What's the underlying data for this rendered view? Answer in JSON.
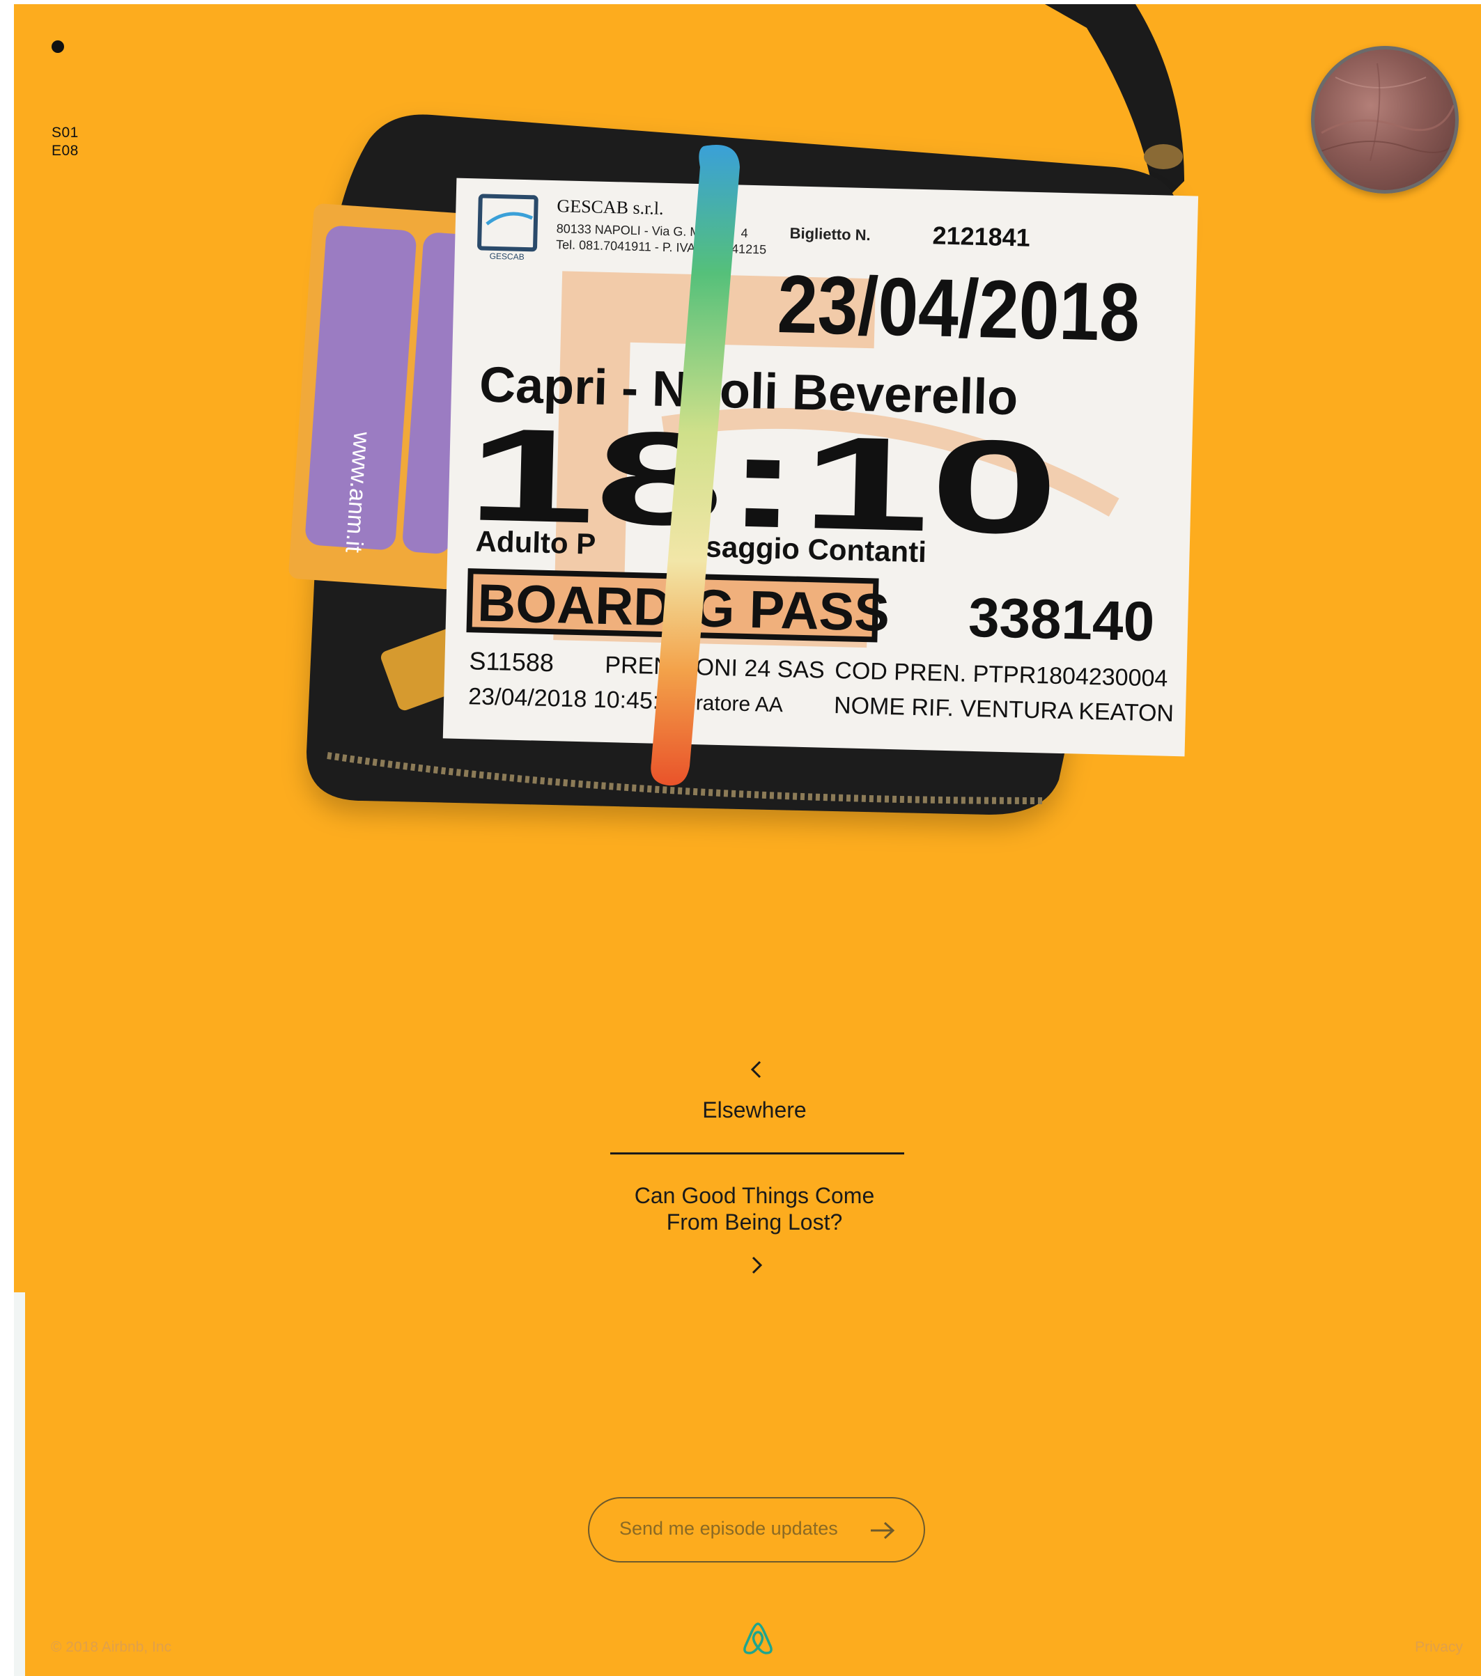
{
  "episode": {
    "season": "S01",
    "episode": "E08"
  },
  "hero": {
    "ticket": {
      "company": "GESCAB s.r.l.",
      "address_line1": "80133 NAPOLI - Via G. Me",
      "address_line1_end": "4",
      "address_line2": "Tel. 081.7041911 - P. IVA 06",
      "address_line2_end": "41215",
      "logo_text": "GESCAB",
      "ticket_label": "Biglietto N.",
      "ticket_number": "2121841",
      "date": "23/04/2018",
      "route_start": "Capri - N",
      "route_end": "oli Beverello",
      "time": "18:10",
      "fare_start": "Adulto P",
      "fare_end": "saggio Contanti",
      "boarding_pass_start": "BOARDI",
      "boarding_pass_end": "G PASS",
      "booking_number": "338140",
      "code_left": "S11588",
      "issue_datetime": "23/04/2018 10:45:50",
      "agency_start": "PREN",
      "agency_end": "ZIONI 24 SAS",
      "operator_end": "eratore AA",
      "booking_code": "COD PREN. PTPR1804230004",
      "passenger": "NOME RIF. VENTURA KEATON"
    },
    "card_url": "www.anm.it"
  },
  "nav": {
    "previous_title": "Elsewhere",
    "next_title_line1": "Can Good Things Come",
    "next_title_line2": "From Being Lost?"
  },
  "subscribe": {
    "label": "Send me episode updates"
  },
  "footer": {
    "copyright": "© 2018 Airbnb, Inc",
    "privacy": "Privacy"
  },
  "icons": {
    "prev": "chevron-left-icon",
    "next": "chevron-right-icon",
    "arrow": "arrow-right-icon",
    "logo": "airbnb-logo-icon"
  },
  "colors": {
    "background": "#FDAC1E",
    "text": "#1a1a1a",
    "logo": "#1FA58D",
    "muted": "#e0a04a"
  }
}
